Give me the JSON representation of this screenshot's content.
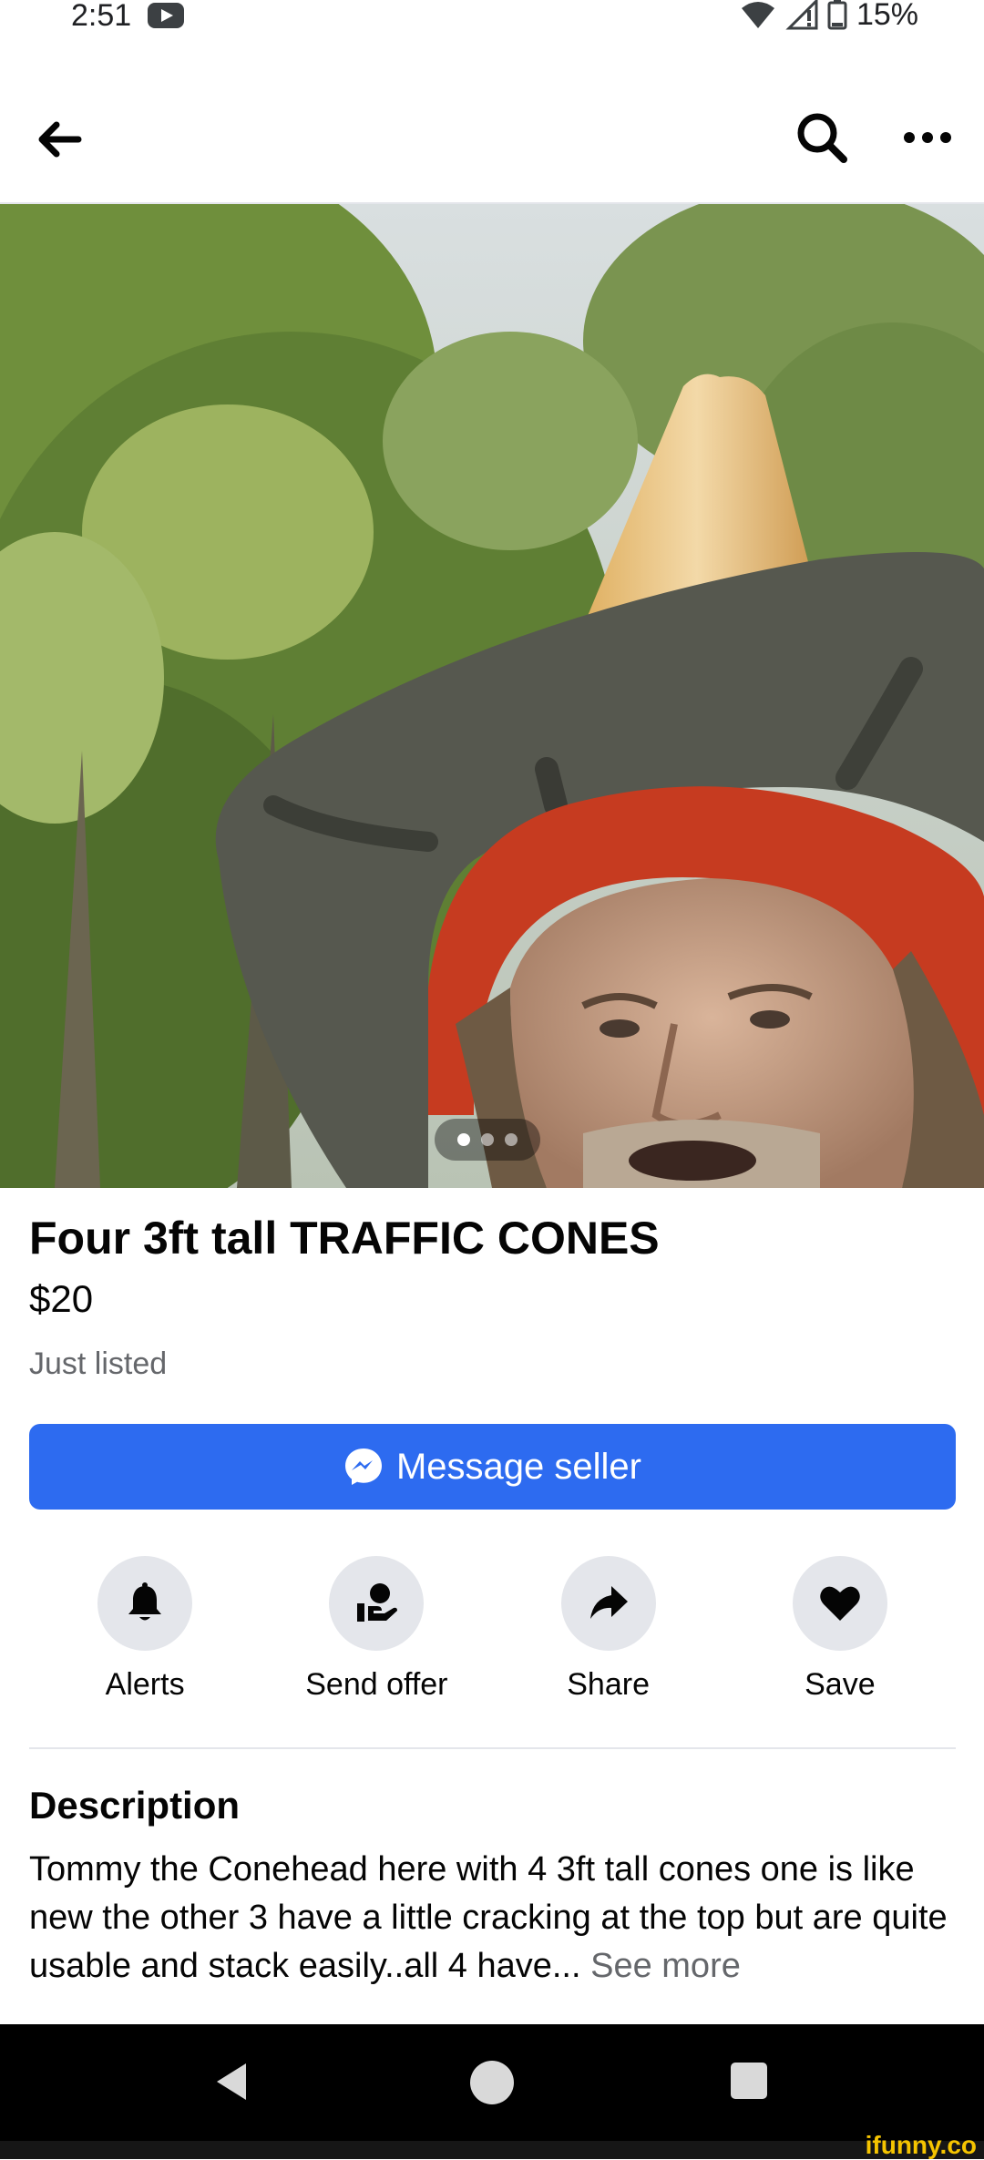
{
  "status_bar": {
    "time": "2:51",
    "battery": "15%",
    "icons": [
      "youtube-icon",
      "wifi-icon",
      "signal-icon",
      "battery-icon"
    ]
  },
  "header": {
    "icons": [
      "back-arrow-icon",
      "search-icon",
      "more-icon"
    ]
  },
  "photo": {
    "page_count": 3,
    "active_index": 0
  },
  "listing": {
    "title": "Four 3ft tall TRAFFIC CONES",
    "price": "$20",
    "listed": "Just listed",
    "message_button": "Message seller"
  },
  "actions": [
    {
      "label": "Alerts",
      "icon": "bell-icon"
    },
    {
      "label": "Send offer",
      "icon": "send-offer-icon"
    },
    {
      "label": "Share",
      "icon": "share-icon"
    },
    {
      "label": "Save",
      "icon": "heart-icon"
    }
  ],
  "description": {
    "heading": "Description",
    "text": "Tommy the Conehead here with 4 3ft tall cones one is like new the other 3 have a little cracking at the top but are quite usable and stack easily..all 4 have...",
    "see_more": "See more"
  },
  "watermark": "ifunny.co",
  "colors": {
    "accent": "#2d6bf0",
    "secondary_text": "#65676b",
    "button_bg": "#e4e6eb"
  }
}
